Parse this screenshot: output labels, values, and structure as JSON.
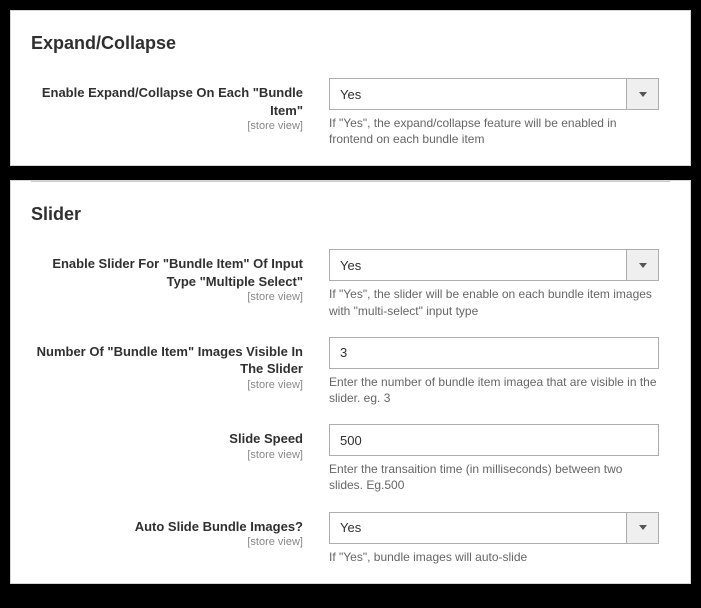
{
  "sections": {
    "expand": {
      "title": "Expand/Collapse",
      "fields": {
        "enable": {
          "label": "Enable Expand/Collapse On Each \"Bundle Item\"",
          "scope": "[store view]",
          "value": "Yes",
          "help": "If \"Yes\", the expand/collapse feature will be enabled in frontend on each bundle item"
        }
      }
    },
    "slider": {
      "title": "Slider",
      "fields": {
        "enable": {
          "label": "Enable Slider For \"Bundle Item\" Of Input Type \"Multiple Select\"",
          "scope": "[store view]",
          "value": "Yes",
          "help": "If \"Yes\", the slider will be enable on each bundle item images with \"multi-select\" input type"
        },
        "count": {
          "label": "Number Of \"Bundle Item\" Images Visible In The Slider",
          "scope": "[store view]",
          "value": "3",
          "help": "Enter the number of bundle item imagea that are visible in the slider. eg. 3"
        },
        "speed": {
          "label": "Slide Speed",
          "scope": "[store view]",
          "value": "500",
          "help": "Enter the transaition time (in milliseconds) between two slides. Eg.500"
        },
        "auto": {
          "label": "Auto Slide Bundle Images?",
          "scope": "[store view]",
          "value": "Yes",
          "help": "If \"Yes\", bundle images will auto-slide"
        }
      }
    }
  }
}
